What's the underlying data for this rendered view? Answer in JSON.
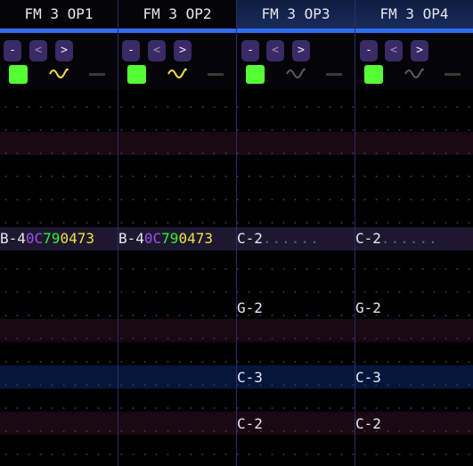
{
  "channels": [
    {
      "title": "FM 3 OP1",
      "wave_color": "#f0e040"
    },
    {
      "title": "FM 3 OP2",
      "wave_color": "#f0e040"
    },
    {
      "title": "FM 3 OP3",
      "wave_color": "#666666"
    },
    {
      "title": "FM 3 OP4",
      "wave_color": "#666666"
    }
  ],
  "buttons": {
    "minus": "-",
    "prev": "<",
    "next": ">"
  },
  "pattern": {
    "ch1_row": {
      "note": "B-4",
      "ins": "0C",
      "vol": "79",
      "fx": "0473"
    },
    "ch2_row": {
      "note": "B-4",
      "ins": "0C",
      "vol": "79",
      "fx": "0473"
    },
    "ch3": {
      "note1": "C-2",
      "trail": "......",
      "note2": "G-2",
      "note3": "C-3",
      "note4": "C-2"
    },
    "ch4": {
      "note1": "C-2",
      "trail": "......",
      "note2": "G-2",
      "note3": "C-3",
      "note4": "C-2"
    }
  },
  "colors": {
    "accent": "#2f6df5",
    "enabled": "#55ff33",
    "instrument": "#a04ff0",
    "volume": "#33ee33",
    "effect": "#f0e040"
  }
}
